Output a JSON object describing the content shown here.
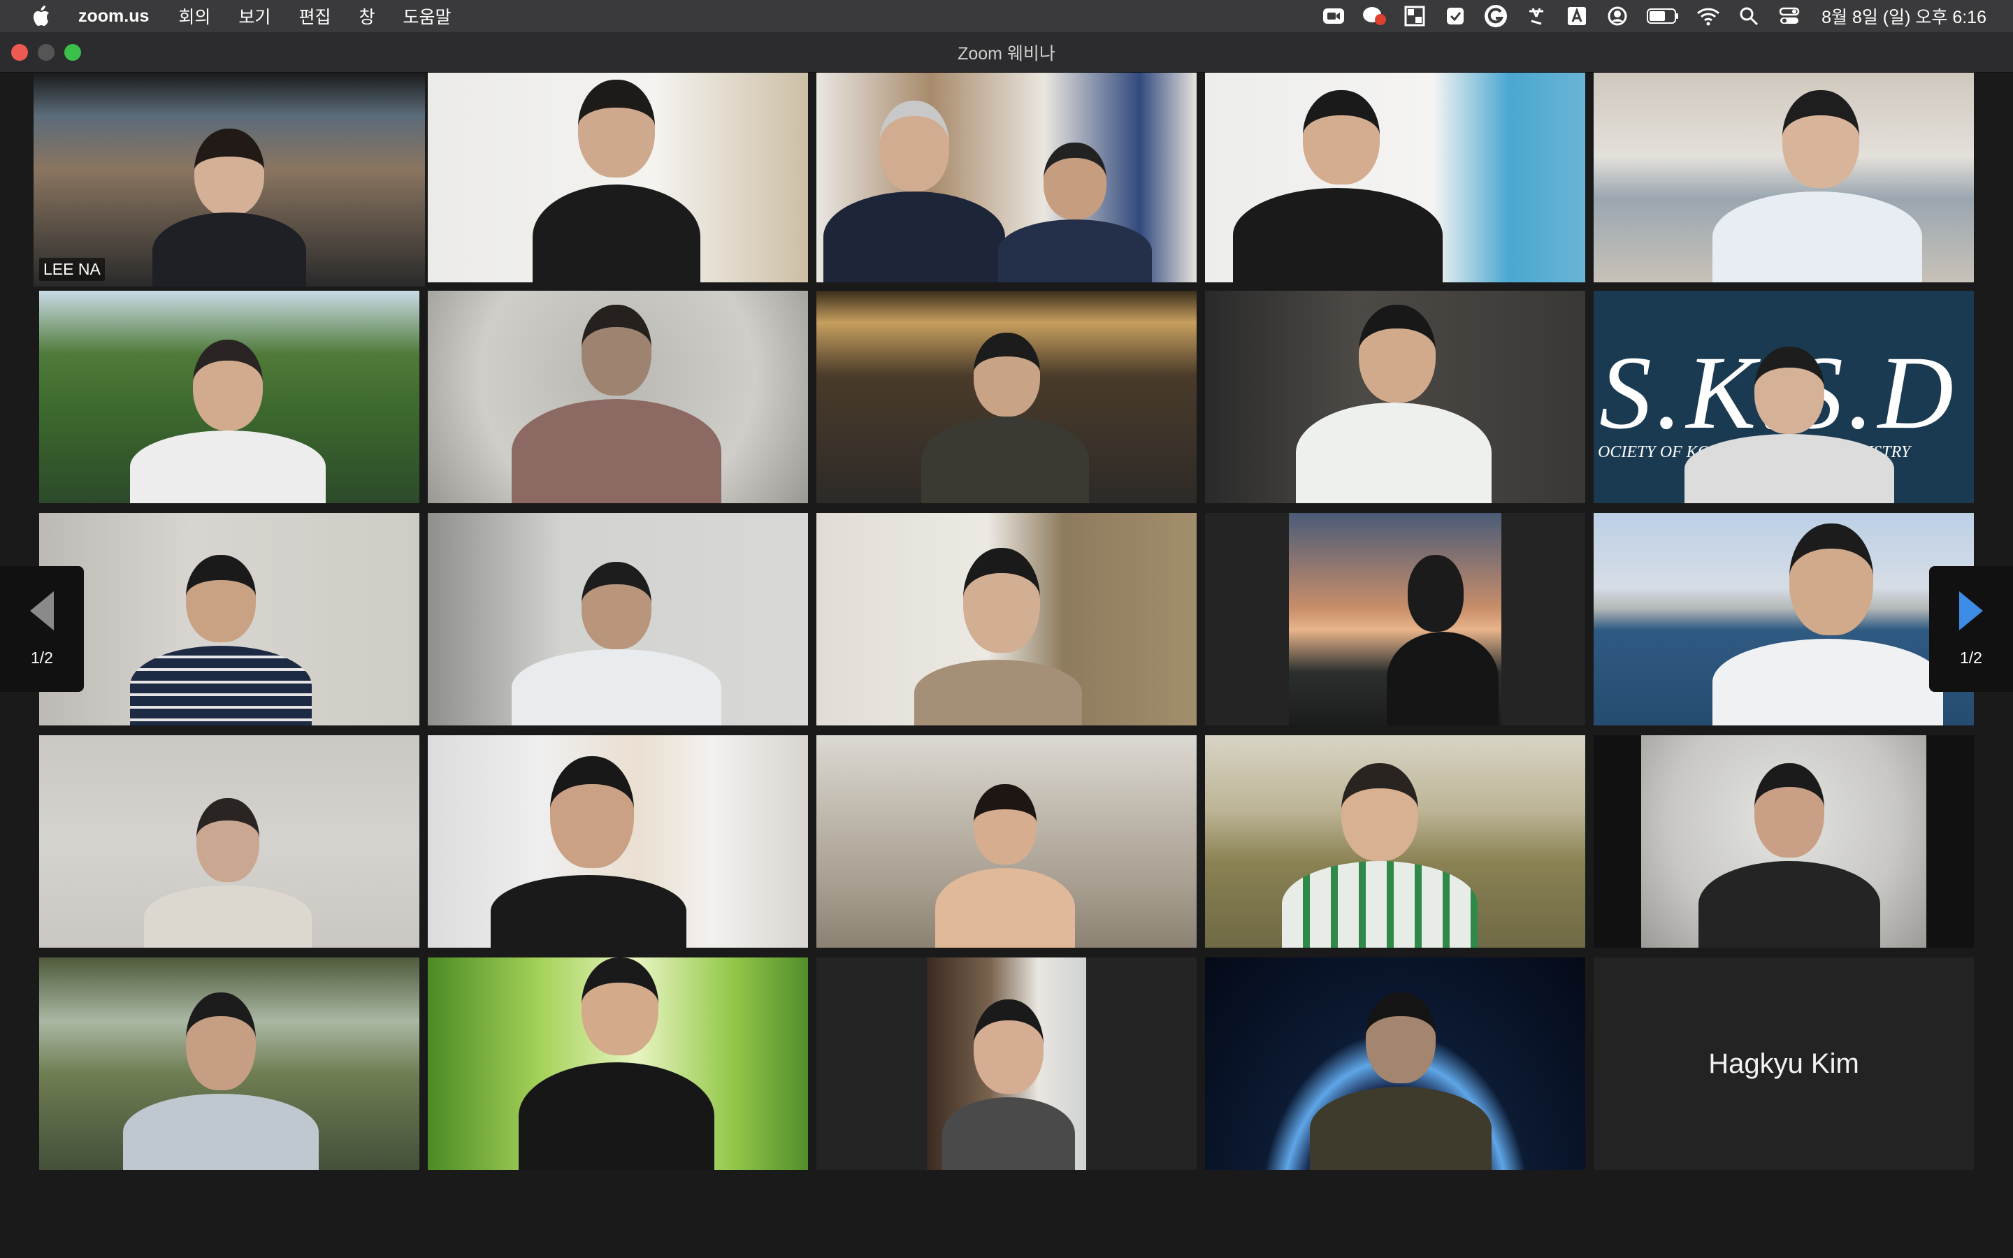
{
  "menubar": {
    "app": "zoom.us",
    "items": [
      "회의",
      "보기",
      "편집",
      "창",
      "도움말"
    ],
    "clock": "8월 8일 (일) 오후 6:16",
    "tray_icons": [
      "zoom-camera-icon",
      "chat-badge-icon",
      "window-grid-icon",
      "checkbox-icon",
      "grammarly-icon",
      "input-tool-icon",
      "keyboard-a-icon",
      "user-circle-icon",
      "battery-icon",
      "wifi-icon",
      "search-icon",
      "control-center-icon"
    ]
  },
  "window": {
    "title": "Zoom 웨비나"
  },
  "pager": {
    "left_label": "1/2",
    "right_label": "1/2"
  },
  "colors": {
    "active_speaker_border": "#b9d97a",
    "pager_arrow_left": "#8a8a8a",
    "pager_arrow_right": "#3d8ce6"
  },
  "participants": [
    {
      "label": "LEE NA",
      "active": true
    },
    {
      "label": ""
    },
    {
      "label": ""
    },
    {
      "label": ""
    },
    {
      "label": ""
    },
    {
      "label": ""
    },
    {
      "label": ""
    },
    {
      "label": ""
    },
    {
      "label": ""
    },
    {
      "label": ""
    },
    {
      "label": ""
    },
    {
      "label": ""
    },
    {
      "label": ""
    },
    {
      "label": ""
    },
    {
      "label": ""
    },
    {
      "label": ""
    },
    {
      "label": ""
    },
    {
      "label": ""
    },
    {
      "label": ""
    },
    {
      "label": ""
    },
    {
      "label": ""
    },
    {
      "label": ""
    },
    {
      "label": ""
    },
    {
      "label": ""
    },
    {
      "name_only": "Hagkyu Kim"
    }
  ],
  "background_text": {
    "sksd_logo": "S.K.S.D",
    "sksd_sub": "OCIETY OF KOREAN SPECIAL DENTISTRY"
  }
}
